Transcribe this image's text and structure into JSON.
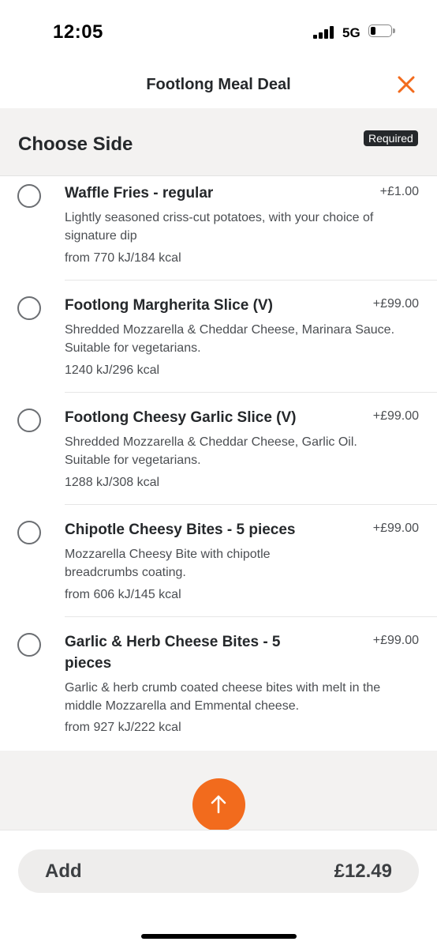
{
  "status_bar": {
    "time": "12:05",
    "network": "5G"
  },
  "header": {
    "title": "Footlong Meal Deal",
    "close_icon": "close-icon",
    "accent": "#f26b1d"
  },
  "section": {
    "title": "Choose Side",
    "badge": "Required"
  },
  "options": [
    {
      "name": "Waffle Fries - regular",
      "price": "+£1.00",
      "desc": "Lightly seasoned criss-cut potatoes, with your choice of signature dip",
      "kcal": "from 770 kJ/184 kcal"
    },
    {
      "name": "Footlong Margherita Slice (V)",
      "price": "+£99.00",
      "desc": "Shredded Mozzarella & Cheddar Cheese, Marinara Sauce. Suitable for vegetarians.",
      "kcal": "1240 kJ/296 kcal"
    },
    {
      "name": "Footlong Cheesy Garlic Slice (V)",
      "price": "+£99.00",
      "desc": "Shredded Mozzarella & Cheddar Cheese, Garlic Oil. Suitable for vegetarians.",
      "kcal": "1288 kJ/308 kcal"
    },
    {
      "name": "Chipotle Cheesy Bites - 5 pieces",
      "price": "+£99.00",
      "desc": "Mozzarella Cheesy Bite with chipotle breadcrumbs coating.",
      "kcal": "from 606 kJ/145 kcal"
    },
    {
      "name": "Garlic & Herb Cheese Bites - 5 pieces",
      "price": "+£99.00",
      "desc": "Garlic & herb crumb coated cheese bites with melt in the middle Mozzarella and Emmental cheese.",
      "kcal": "from 927 kJ/222 kcal"
    }
  ],
  "scroll_top": {
    "icon": "arrow-up-icon"
  },
  "footer": {
    "add_label": "Add",
    "price": "£12.49"
  }
}
